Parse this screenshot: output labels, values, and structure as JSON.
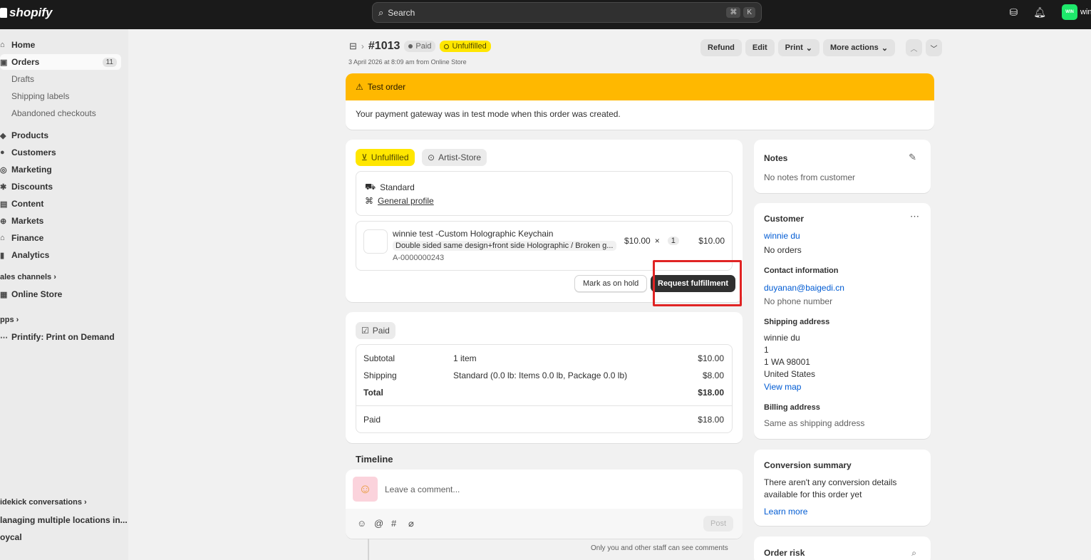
{
  "topbar": {
    "logo": "shopify",
    "search_placeholder": "Search",
    "kbd1": "⌘",
    "kbd2": "K",
    "avatar_initials": "WIN",
    "user_name": "winnie"
  },
  "sidebar": {
    "items": [
      {
        "label": "Home"
      },
      {
        "label": "Orders",
        "count": "11"
      },
      {
        "label": "Drafts"
      },
      {
        "label": "Shipping labels"
      },
      {
        "label": "Abandoned checkouts"
      },
      {
        "label": "Products"
      },
      {
        "label": "Customers"
      },
      {
        "label": "Marketing"
      },
      {
        "label": "Discounts"
      },
      {
        "label": "Content"
      },
      {
        "label": "Markets"
      },
      {
        "label": "Finance"
      },
      {
        "label": "Analytics"
      }
    ],
    "sales_channels": "ales channels",
    "online_store": "Online Store",
    "apps": "pps",
    "printify": "Printify: Print on Demand",
    "sidekick": "idekick conversations",
    "convo1": "lanaging multiple locations in...",
    "convo2": "oycal"
  },
  "order": {
    "number": "#1013",
    "paid_badge": "Paid",
    "unfulfilled_badge": "Unfulfilled",
    "date": "3 April 2026 at 8:09 am from Online Store",
    "actions": {
      "refund": "Refund",
      "edit": "Edit",
      "print": "Print",
      "more": "More actions"
    }
  },
  "test_order": {
    "title": "Test order",
    "message": "Your payment gateway was in test mode when this order was created."
  },
  "fulfillment": {
    "status": "Unfulfilled",
    "location": "Artist-Store",
    "shipping_method": "Standard",
    "profile": "General profile",
    "item_name": "winnie test -Custom Holographic Keychain",
    "variant": "Double sided same design+front side Holographic / Broken g...",
    "sku": "A-0000000243",
    "price": "$10.00",
    "times": "×",
    "qty": "1",
    "line_total": "$10.00",
    "hold_button": "Mark as on hold",
    "request_button": "Request fulfillment"
  },
  "payment": {
    "status": "Paid",
    "subtotal_label": "Subtotal",
    "subtotal_desc": "1 item",
    "subtotal_value": "$10.00",
    "shipping_label": "Shipping",
    "shipping_desc": "Standard (0.0 lb: Items 0.0 lb, Package 0.0 lb)",
    "shipping_value": "$8.00",
    "total_label": "Total",
    "total_value": "$18.00",
    "paid_label": "Paid",
    "paid_value": "$18.00"
  },
  "timeline": {
    "title": "Timeline",
    "placeholder": "Leave a comment...",
    "post": "Post",
    "note": "Only you and other staff can see comments"
  },
  "notes": {
    "title": "Notes",
    "text": "No notes from customer"
  },
  "customer": {
    "title": "Customer",
    "name": "winnie du",
    "orders": "No orders",
    "contact_title": "Contact information",
    "email": "duyanan@baigedi.cn",
    "phone": "No phone number",
    "shipping_title": "Shipping address",
    "addr1": "winnie du",
    "addr2": "1",
    "addr3": "1 WA 98001",
    "addr4": "United States",
    "view_map": "View map",
    "billing_title": "Billing address",
    "billing_text": "Same as shipping address"
  },
  "conversion": {
    "title": "Conversion summary",
    "text1": "There aren't any conversion details",
    "text2": "available for this order yet",
    "link": "Learn more"
  },
  "risk": {
    "title": "Order risk"
  }
}
